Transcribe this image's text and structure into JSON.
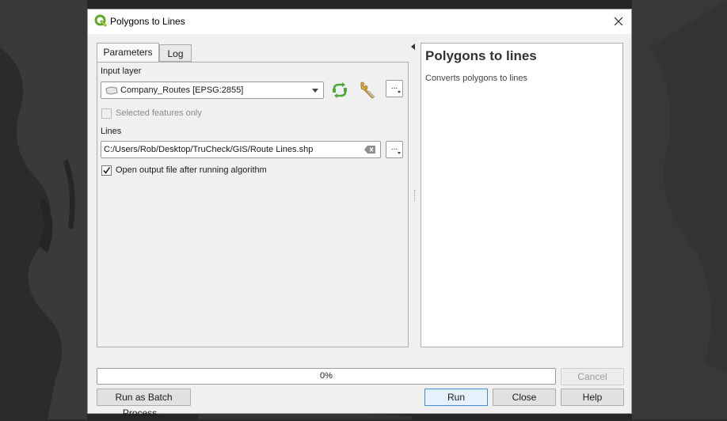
{
  "window": {
    "title": "Polygons to Lines"
  },
  "tabs": [
    {
      "label": "Parameters",
      "active": true
    },
    {
      "label": "Log",
      "active": false
    }
  ],
  "parameters": {
    "input_layer_label": "Input layer",
    "input_layer_value": "Company_Routes [EPSG:2855]",
    "selected_only_label": "Selected features only",
    "selected_only_checked": false,
    "lines_label": "Lines",
    "lines_value": "C:/Users/Rob/Desktop/TruCheck/GIS/Route Lines.shp",
    "open_output_label": "Open output file after running algorithm",
    "open_output_checked": true,
    "browse_label": "..."
  },
  "help": {
    "title": "Polygons to lines",
    "description": "Converts polygons to lines"
  },
  "progress": {
    "value": 0,
    "text": "0%"
  },
  "buttons": {
    "cancel": "Cancel",
    "batch": "Run as Batch Process...",
    "run": "Run",
    "close": "Close",
    "help": "Help"
  },
  "colors": {
    "accent": "#3c8dde",
    "qgis_green": "#5fa82a",
    "refresh_green": "#4ea83a"
  }
}
